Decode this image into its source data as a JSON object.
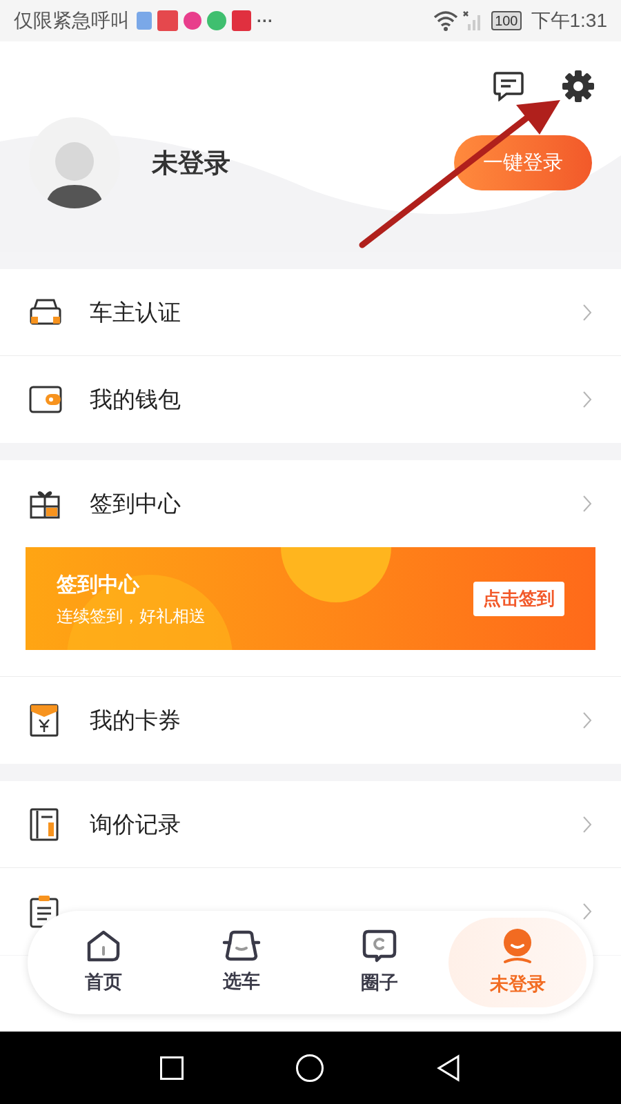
{
  "status_bar": {
    "carrier": "仅限紧急呼叫",
    "more": "···",
    "battery": "100",
    "time": "下午1:31"
  },
  "profile": {
    "name": "未登录",
    "login_button": "一键登录"
  },
  "menu_groups": [
    {
      "items": [
        {
          "kind": "car",
          "label": "车主认证"
        },
        {
          "kind": "wallet",
          "label": "我的钱包"
        }
      ]
    },
    {
      "items": [
        {
          "kind": "gift",
          "label": "签到中心"
        }
      ],
      "banner": {
        "title": "签到中心",
        "subtitle": "连续签到，好礼相送",
        "button": "点击签到"
      }
    },
    {
      "items": [
        {
          "kind": "coupon",
          "label": "我的卡券"
        }
      ]
    },
    {
      "items": [
        {
          "kind": "inquiry",
          "label": "询价记录"
        },
        {
          "kind": "order"
        }
      ]
    }
  ],
  "tab_bar": [
    {
      "kind": "home",
      "label": "首页",
      "selected": false
    },
    {
      "kind": "car",
      "label": "选车",
      "selected": false
    },
    {
      "kind": "circle",
      "label": "圈子",
      "selected": false
    },
    {
      "kind": "user",
      "label": "未登录",
      "selected": true
    }
  ]
}
